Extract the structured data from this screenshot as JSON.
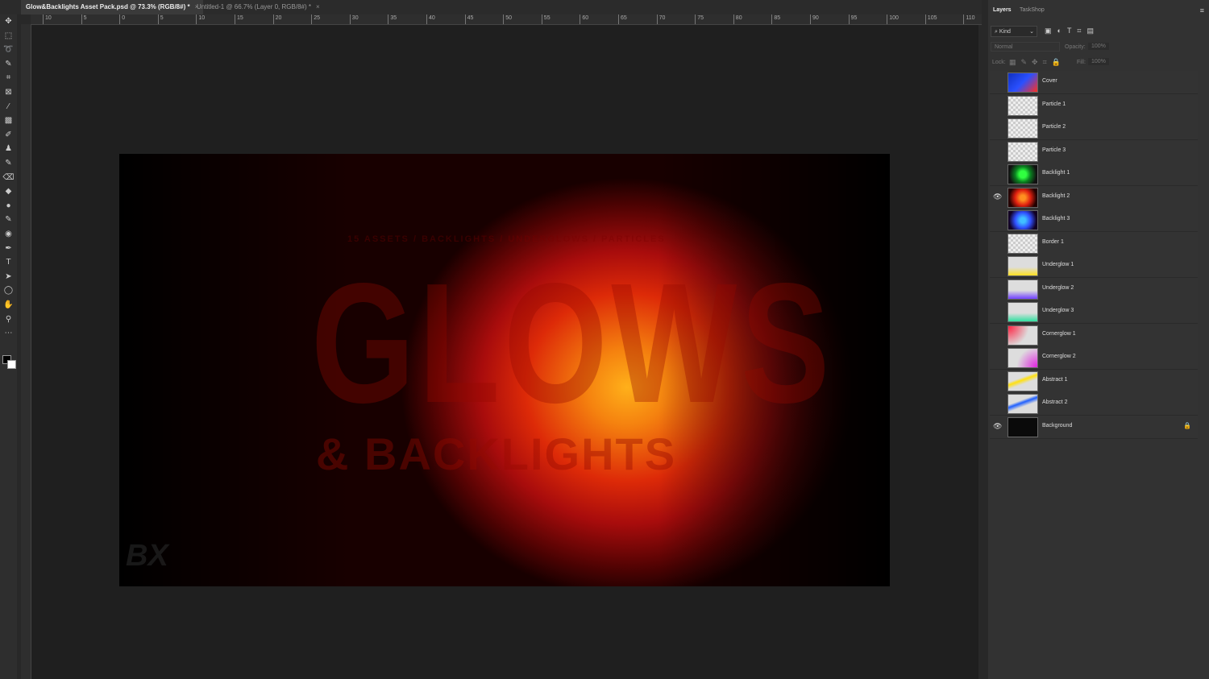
{
  "tabs": [
    {
      "label": "Glow&Backlights Asset Pack.psd @ 73.3% (RGB/8#) *"
    },
    {
      "label": "Untitled-1 @ 66.7% (Layer 0, RGB/8#) *"
    }
  ],
  "close_glyph": "×",
  "ruler_labels": [
    "10",
    "5",
    "0",
    "5",
    "10",
    "15",
    "20",
    "25",
    "30",
    "35",
    "40",
    "45",
    "50",
    "55",
    "60",
    "65",
    "70",
    "75",
    "80",
    "85",
    "90",
    "95",
    "100",
    "105",
    "110"
  ],
  "canvas": {
    "subtitle": "15 ASSETS / BACKLIGHTS / UNDERGLOWS / PARTICLES",
    "title": "GLOWS",
    "title2": "& BACKLIGHTS",
    "logo": "BX"
  },
  "panel": {
    "tabs": [
      "Layers",
      "TaskShop"
    ],
    "filter": "Kind",
    "blend_mode": "Normal",
    "opacity_label": "Opacity:",
    "opacity": "100%",
    "lock_label": "Lock:",
    "fill_label": "Fill:",
    "fill": "100%"
  },
  "layers": [
    {
      "name": "Cover",
      "visible": false,
      "thumb": "linear-gradient(135deg,#1030c0,#2a50ff 50%,#ff3020)"
    },
    {
      "name": "Particle 1",
      "visible": false,
      "thumb": ""
    },
    {
      "name": "Particle 2",
      "visible": false,
      "thumb": ""
    },
    {
      "name": "Particle 3",
      "visible": false,
      "thumb": ""
    },
    {
      "name": "Backlight 1",
      "visible": false,
      "thumb": "radial-gradient(circle,#30ff40 20%,#0a8020 45%,#111 80%)"
    },
    {
      "name": "Backlight 2",
      "visible": true,
      "thumb": "radial-gradient(circle,#ff9020 15%,#e02010 45%,#200 80%)"
    },
    {
      "name": "Backlight 3",
      "visible": false,
      "thumb": "radial-gradient(circle,#40c0ff 15%,#3050ff 45%,#102 80%)"
    },
    {
      "name": "Border 1",
      "visible": false,
      "thumb": ""
    },
    {
      "name": "Underglow 1",
      "visible": false,
      "thumb": "linear-gradient(180deg,transparent 55%,#ffe020)"
    },
    {
      "name": "Underglow 2",
      "visible": false,
      "thumb": "linear-gradient(180deg,transparent 55%,#7040ff)"
    },
    {
      "name": "Underglow 3",
      "visible": false,
      "thumb": "linear-gradient(180deg,transparent 55%,#30e0a0)"
    },
    {
      "name": "Cornerglow 1",
      "visible": false,
      "thumb": "radial-gradient(circle at 0 0,#ff2040,transparent 60%)"
    },
    {
      "name": "Cornerglow 2",
      "visible": false,
      "thumb": "radial-gradient(circle at 100% 100%,#e020e0,transparent 60%)"
    },
    {
      "name": "Abstract 1",
      "visible": false,
      "thumb": "linear-gradient(160deg,transparent 35%,#ffe010 45%,transparent 60%)"
    },
    {
      "name": "Abstract 2",
      "visible": false,
      "thumb": "linear-gradient(160deg,transparent 35%,#2060ff 45%,transparent 60%)"
    },
    {
      "name": "Background",
      "visible": true,
      "locked": true,
      "thumb": "#0a0a0a"
    }
  ]
}
